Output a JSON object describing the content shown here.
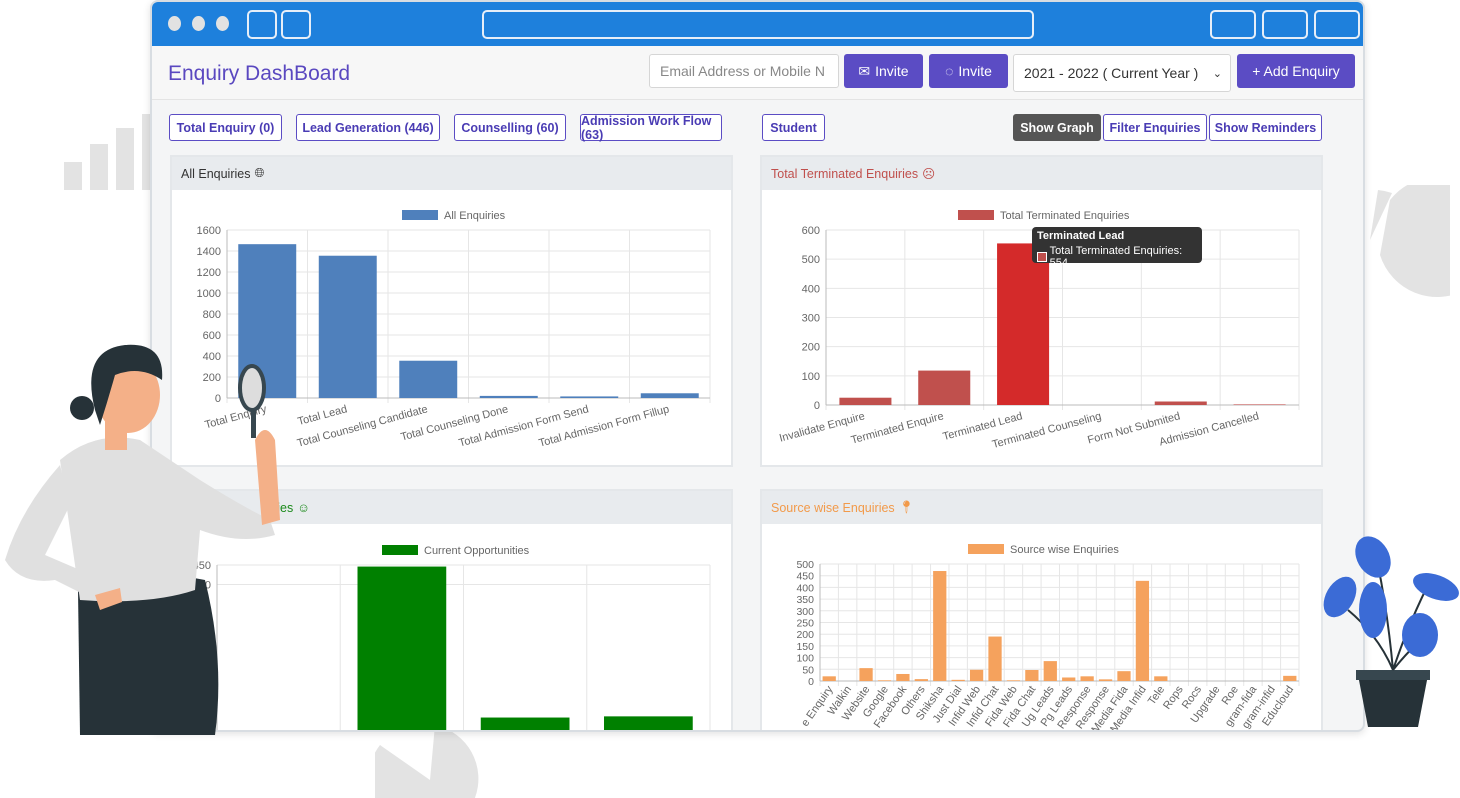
{
  "header": {
    "title": "Enquiry DashBoard",
    "invite_placeholder": "Email Address or Mobile N",
    "email_invite": "Invite",
    "whatsapp_invite": "Invite",
    "year_select": "2021 - 2022 ( Current Year )",
    "add_enquiry": "+ Add Enquiry"
  },
  "tabs": [
    {
      "label": "Total Enquiry (0)"
    },
    {
      "label": "Lead Generation (446)"
    },
    {
      "label": "Counselling (60)"
    },
    {
      "label": "Admission Work Flow (63)"
    },
    {
      "label": "Student"
    }
  ],
  "actions": {
    "show_graph": "Show Graph",
    "filter": "Filter Enquiries",
    "reminders": "Show Reminders"
  },
  "panels": {
    "all": "All Enquiries",
    "terminated": "Total Terminated Enquiries",
    "current": "ities",
    "source": "Source wise Enquiries"
  },
  "tooltip": {
    "title": "Terminated Lead",
    "text": "Total Terminated Enquiries: 554"
  },
  "colors": {
    "accent": "#5b4cc4",
    "titlebar": "#1e80dc",
    "blue": "#4f80bc",
    "red": "#c0504d",
    "redHover": "#d42a2a",
    "green": "#008000",
    "orange": "#f5a25d"
  },
  "chart_data": [
    {
      "type": "bar",
      "legend": "All Enquiries",
      "categories": [
        "Total Enquiry",
        "Total Lead",
        "Total Counseling Candidate",
        "Total Counseling Done",
        "Total Admission Form Send",
        "Total Admission Form Fillup"
      ],
      "values": [
        1465,
        1355,
        355,
        20,
        15,
        45
      ],
      "ylim": [
        0,
        1600
      ],
      "yticks": [
        0,
        200,
        400,
        600,
        800,
        1000,
        1200,
        1400,
        1600
      ],
      "grid": true,
      "legend_position": "top"
    },
    {
      "type": "bar",
      "legend": "Total Terminated Enquiries",
      "categories": [
        "Invalidate Enquire",
        "Terminated Enquire",
        "Terminated Lead",
        "Terminated Counseling",
        "Form Not Submited",
        "Admission Cancelled"
      ],
      "values": [
        25,
        118,
        554,
        0,
        12,
        2
      ],
      "ylim": [
        0,
        600
      ],
      "yticks": [
        0,
        100,
        200,
        300,
        400,
        500,
        600
      ],
      "grid": true,
      "legend_position": "top"
    },
    {
      "type": "bar",
      "legend": "Current Opportunities",
      "categories": [
        "",
        "",
        "",
        ""
      ],
      "values": [
        0,
        446,
        60,
        63
      ],
      "ylim": [
        0,
        450
      ],
      "yticks": [
        400,
        450
      ],
      "grid": true,
      "legend_position": "top"
    },
    {
      "type": "bar",
      "legend": "Source wise Enquiries",
      "categories": [
        "e Enquiry",
        "Walkin",
        "Website",
        "Google",
        "Facebook",
        "Others",
        "Shiksha",
        "Just Dial",
        "Infid Web",
        "Infid Chat",
        "Fida Web",
        "Fida Chat",
        "Ug Leads",
        "Pg Leads",
        "Response",
        "Response",
        "Media Fida",
        "Media Infid",
        "Tele",
        "Rops",
        "Rocs",
        "Upgrade",
        "Roe",
        "gram-fida",
        "gram-infid",
        "Educloud"
      ],
      "values": [
        20,
        0,
        55,
        3,
        30,
        8,
        470,
        5,
        48,
        190,
        3,
        47,
        85,
        15,
        20,
        7,
        42,
        428,
        20,
        0,
        0,
        0,
        0,
        0,
        0,
        22
      ],
      "ylim": [
        0,
        500
      ],
      "yticks": [
        0,
        50,
        100,
        150,
        200,
        250,
        300,
        350,
        400,
        450,
        500
      ],
      "grid": true,
      "legend_position": "top"
    }
  ]
}
